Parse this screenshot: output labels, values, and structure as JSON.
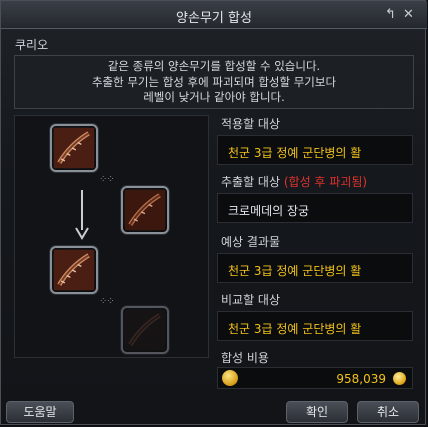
{
  "window": {
    "title": "양손무기 합성",
    "reset_icon": "undo-icon",
    "close_icon": "close-icon"
  },
  "npc_label": "쿠리오",
  "description": [
    "같은 종류의 양손무기를 합성할 수 있습니다.",
    "추출한 무기는 합성 후에 파괴되며 합성할 무기보다",
    "레벨이 낮거나 같아야 합니다."
  ],
  "fields": {
    "target_label": "적용할 대상",
    "target_value": "천군 3급 정예 군단병의 활",
    "extract_label": "추출할 대상",
    "extract_warning": "(합성 후 파괴됨)",
    "extract_value": "크로메데의 장궁",
    "result_label": "예상 결과물",
    "result_value": "천군 3급 정예 군단병의 활",
    "compare_label": "비교할 대상",
    "compare_value": "천군 3급 정예 군단병의 활",
    "cost_label": "합성 비용",
    "cost_value": "958,039"
  },
  "buttons": {
    "help": "도움말",
    "confirm": "확인",
    "cancel": "취소"
  },
  "colors": {
    "item_name": "#f2c21a",
    "warning": "#e2322c",
    "common_item": "#e4e6ea"
  }
}
